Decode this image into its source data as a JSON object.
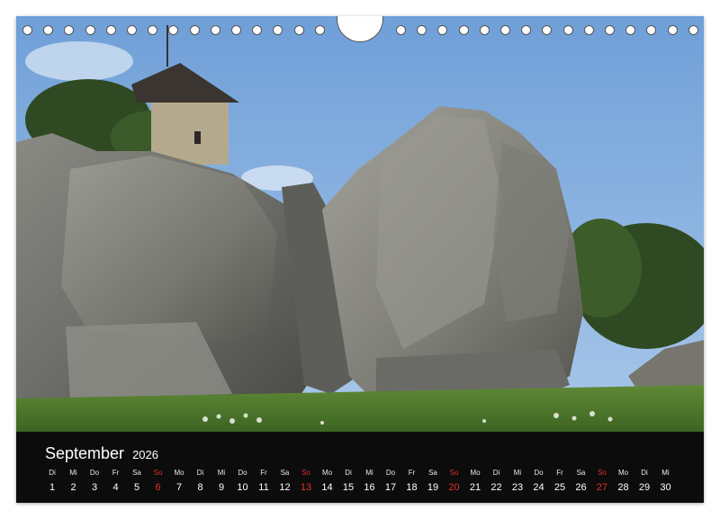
{
  "calendar": {
    "month": "September",
    "year": "2026",
    "days": [
      {
        "wd": "Di",
        "n": "1"
      },
      {
        "wd": "Mi",
        "n": "2"
      },
      {
        "wd": "Do",
        "n": "3"
      },
      {
        "wd": "Fr",
        "n": "4"
      },
      {
        "wd": "Sa",
        "n": "5"
      },
      {
        "wd": "So",
        "n": "6",
        "sun": true
      },
      {
        "wd": "Mo",
        "n": "7"
      },
      {
        "wd": "Di",
        "n": "8"
      },
      {
        "wd": "Mi",
        "n": "9"
      },
      {
        "wd": "Do",
        "n": "10"
      },
      {
        "wd": "Fr",
        "n": "11"
      },
      {
        "wd": "Sa",
        "n": "12"
      },
      {
        "wd": "So",
        "n": "13",
        "sun": true
      },
      {
        "wd": "Mo",
        "n": "14"
      },
      {
        "wd": "Di",
        "n": "15"
      },
      {
        "wd": "Mi",
        "n": "16"
      },
      {
        "wd": "Do",
        "n": "17"
      },
      {
        "wd": "Fr",
        "n": "18"
      },
      {
        "wd": "Sa",
        "n": "19"
      },
      {
        "wd": "So",
        "n": "20",
        "sun": true
      },
      {
        "wd": "Mo",
        "n": "21"
      },
      {
        "wd": "Di",
        "n": "22"
      },
      {
        "wd": "Mi",
        "n": "23"
      },
      {
        "wd": "Do",
        "n": "24"
      },
      {
        "wd": "Fr",
        "n": "25"
      },
      {
        "wd": "Sa",
        "n": "26"
      },
      {
        "wd": "So",
        "n": "27",
        "sun": true
      },
      {
        "wd": "Mo",
        "n": "28"
      },
      {
        "wd": "Di",
        "n": "29"
      },
      {
        "wd": "Mi",
        "n": "30"
      }
    ]
  },
  "colors": {
    "strip_background": "#0c0c0c",
    "sunday_red": "#e0312b",
    "text": "#ffffff"
  }
}
